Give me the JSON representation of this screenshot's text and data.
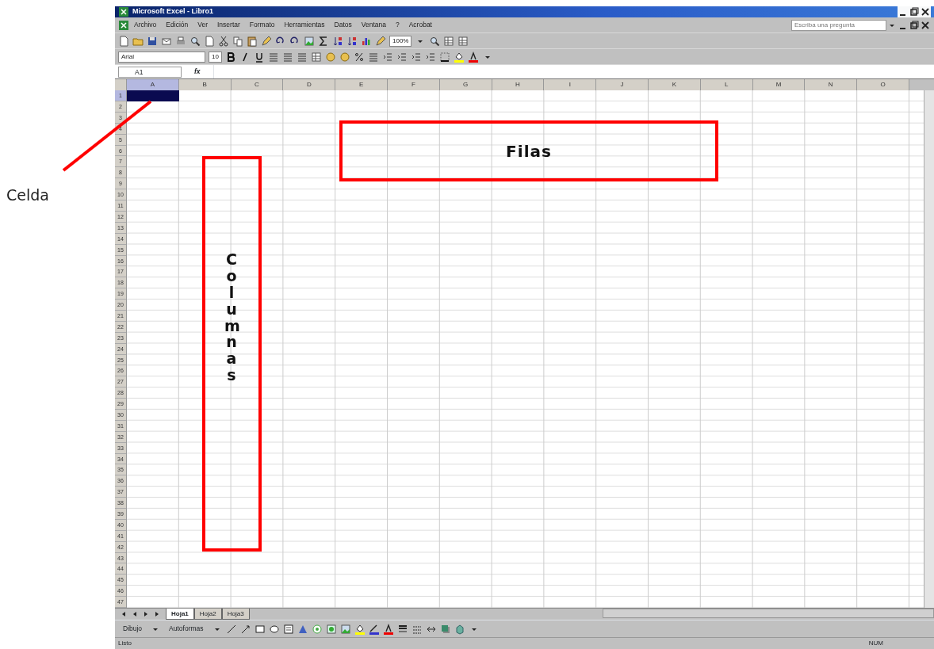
{
  "window": {
    "title": "Microsoft Excel - Libro1"
  },
  "menu": [
    "Archivo",
    "Edición",
    "Ver",
    "Insertar",
    "Formato",
    "Herramientas",
    "Datos",
    "Ventana",
    "?",
    "Acrobat"
  ],
  "help_box": {
    "placeholder": "Escriba una pregunta"
  },
  "standard_toolbar": {
    "zoom": "100%"
  },
  "format_toolbar": {
    "font": "Arial",
    "size": "10"
  },
  "formula_bar": {
    "name_box": "A1",
    "fx": "fx"
  },
  "columns": [
    {
      "label": "A",
      "selected": true
    },
    {
      "label": "B",
      "selected": false
    },
    {
      "label": "C",
      "selected": false
    },
    {
      "label": "D",
      "selected": false
    },
    {
      "label": "E",
      "selected": false
    },
    {
      "label": "F",
      "selected": false
    },
    {
      "label": "G",
      "selected": false
    },
    {
      "label": "H",
      "selected": false
    },
    {
      "label": "I",
      "selected": false
    },
    {
      "label": "J",
      "selected": false
    },
    {
      "label": "K",
      "selected": false
    },
    {
      "label": "L",
      "selected": false
    },
    {
      "label": "M",
      "selected": false
    },
    {
      "label": "N",
      "selected": false
    },
    {
      "label": "O",
      "selected": false
    }
  ],
  "rows": [
    {
      "label": "1",
      "selected": true
    },
    {
      "label": "2",
      "selected": false
    },
    {
      "label": "3",
      "selected": false
    },
    {
      "label": "4",
      "selected": false
    },
    {
      "label": "5",
      "selected": false
    },
    {
      "label": "6",
      "selected": false
    },
    {
      "label": "7",
      "selected": false
    },
    {
      "label": "8",
      "selected": false
    },
    {
      "label": "9",
      "selected": false
    },
    {
      "label": "10",
      "selected": false
    },
    {
      "label": "11",
      "selected": false
    },
    {
      "label": "12",
      "selected": false
    },
    {
      "label": "13",
      "selected": false
    },
    {
      "label": "14",
      "selected": false
    },
    {
      "label": "15",
      "selected": false
    },
    {
      "label": "16",
      "selected": false
    },
    {
      "label": "17",
      "selected": false
    },
    {
      "label": "18",
      "selected": false
    },
    {
      "label": "19",
      "selected": false
    },
    {
      "label": "20",
      "selected": false
    },
    {
      "label": "21",
      "selected": false
    },
    {
      "label": "22",
      "selected": false
    },
    {
      "label": "23",
      "selected": false
    },
    {
      "label": "24",
      "selected": false
    },
    {
      "label": "25",
      "selected": false
    },
    {
      "label": "26",
      "selected": false
    },
    {
      "label": "27",
      "selected": false
    },
    {
      "label": "28",
      "selected": false
    },
    {
      "label": "29",
      "selected": false
    },
    {
      "label": "30",
      "selected": false
    },
    {
      "label": "31",
      "selected": false
    },
    {
      "label": "32",
      "selected": false
    },
    {
      "label": "33",
      "selected": false
    },
    {
      "label": "34",
      "selected": false
    },
    {
      "label": "35",
      "selected": false
    },
    {
      "label": "36",
      "selected": false
    },
    {
      "label": "37",
      "selected": false
    },
    {
      "label": "38",
      "selected": false
    },
    {
      "label": "39",
      "selected": false
    },
    {
      "label": "40",
      "selected": false
    },
    {
      "label": "41",
      "selected": false
    },
    {
      "label": "42",
      "selected": false
    },
    {
      "label": "43",
      "selected": false
    },
    {
      "label": "44",
      "selected": false
    },
    {
      "label": "45",
      "selected": false
    },
    {
      "label": "46",
      "selected": false
    },
    {
      "label": "47",
      "selected": false
    }
  ],
  "sheet_tabs": [
    {
      "label": "Hoja1",
      "selected": true
    },
    {
      "label": "Hoja2",
      "selected": false
    },
    {
      "label": "Hoja3",
      "selected": false
    }
  ],
  "drawing_toolbar": {
    "draw_menu": "Dibujo",
    "autoshapes": "Autoformas"
  },
  "status_bar": {
    "status": "Listo",
    "mode": "NUM"
  },
  "annotations": [
    {
      "kind": "pointer",
      "text": "Celda"
    },
    {
      "kind": "box",
      "text": "Filas"
    },
    {
      "kind": "vertical-box",
      "text": "Columnas"
    }
  ]
}
